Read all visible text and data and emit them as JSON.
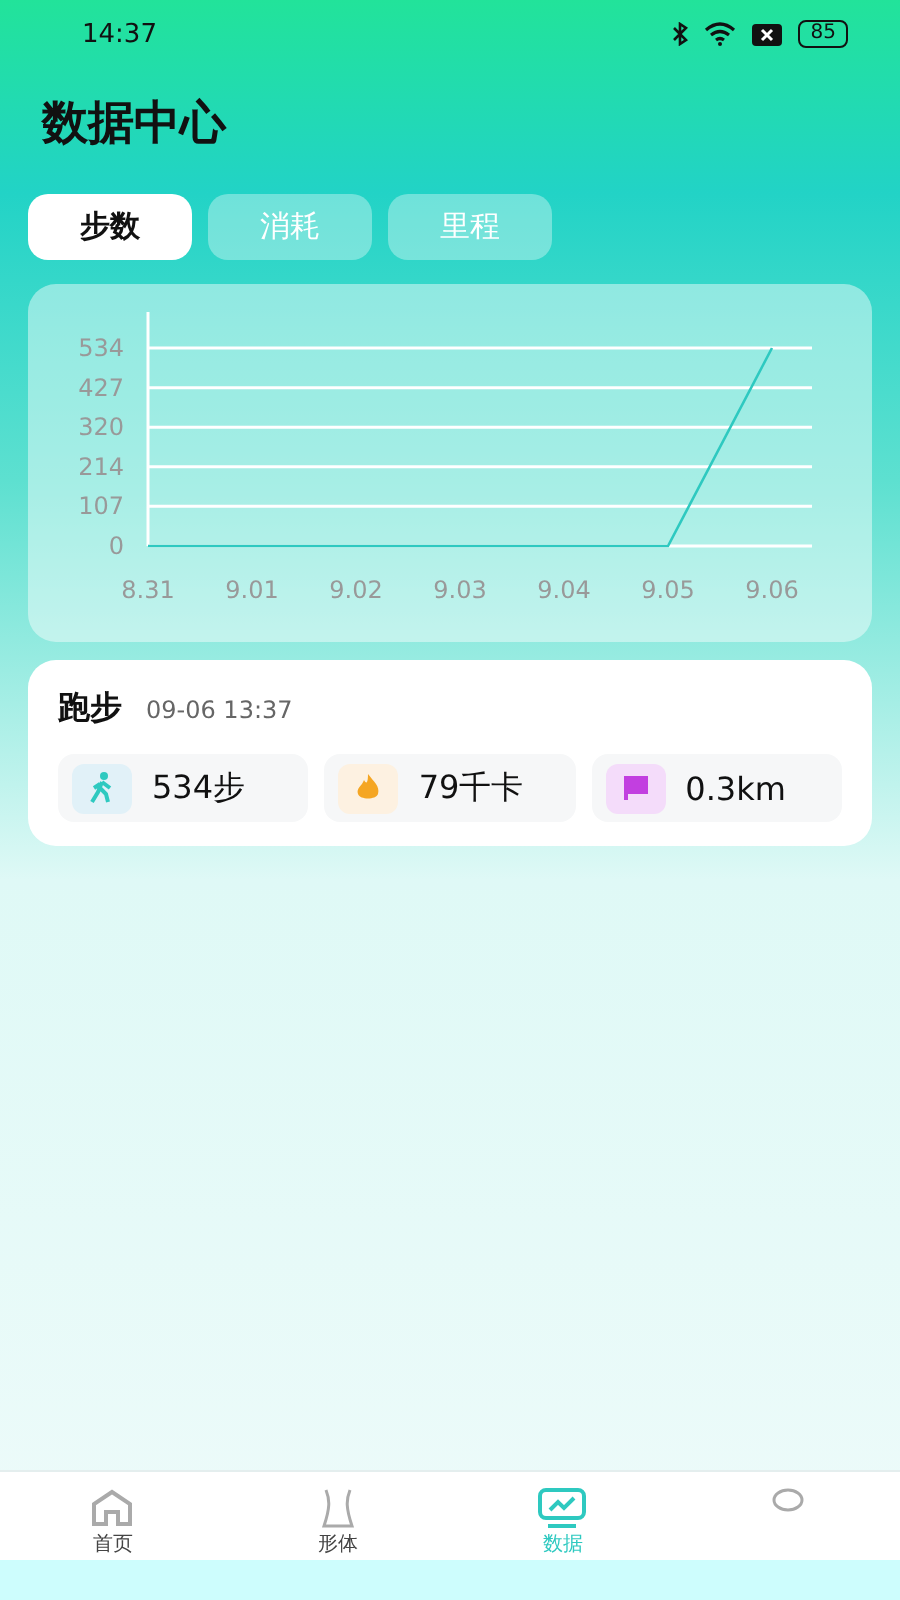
{
  "status_bar": {
    "time": "14:37",
    "battery": "85"
  },
  "title": "数据中心",
  "tabs": [
    {
      "label": "步数",
      "selected": true
    },
    {
      "label": "消耗",
      "selected": false
    },
    {
      "label": "里程",
      "selected": false
    }
  ],
  "chart": {
    "chart_data": {
      "type": "line",
      "categories": [
        "8.31",
        "9.01",
        "9.02",
        "9.03",
        "9.04",
        "9.05",
        "9.06"
      ],
      "yticks": [
        0,
        107,
        214,
        320,
        427,
        534
      ],
      "ylim": [
        0,
        534
      ],
      "grid": true,
      "series": [
        {
          "color": "#2ec9c0",
          "values": [
            0,
            0,
            0,
            0,
            0,
            0,
            534
          ]
        }
      ]
    }
  },
  "record": {
    "title": "跑步",
    "time": "09-06 13:37",
    "stats": [
      {
        "kind": "steps",
        "value": "534步"
      },
      {
        "kind": "calories",
        "value": "79千卡"
      },
      {
        "kind": "distance",
        "value": "0.3km"
      }
    ]
  },
  "nav": [
    {
      "kind": "home",
      "label": "首页",
      "selected": false
    },
    {
      "kind": "body",
      "label": "形体",
      "selected": false
    },
    {
      "kind": "data",
      "label": "数据",
      "selected": true
    },
    {
      "kind": "profile",
      "selected": false
    }
  ]
}
